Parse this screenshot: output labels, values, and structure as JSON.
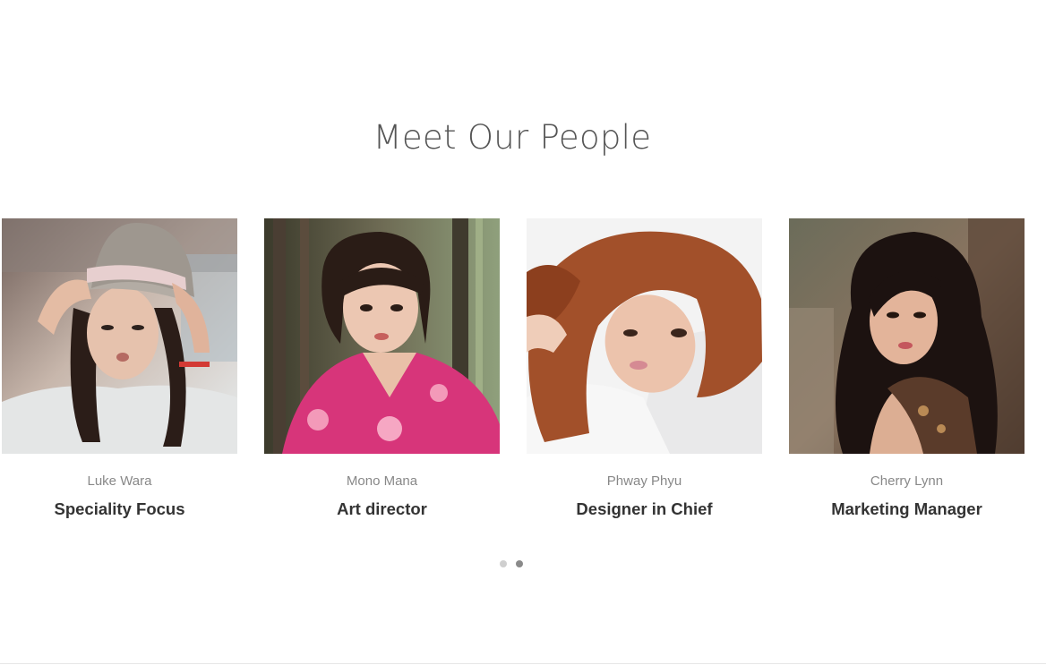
{
  "section": {
    "title": "Meet Our People"
  },
  "team": [
    {
      "name": "Luke Wara",
      "role": "Speciality Focus",
      "photo_icon": "portrait-woman-hat"
    },
    {
      "name": "Mono Mana",
      "role": "Art director",
      "photo_icon": "portrait-woman-pink-kimono"
    },
    {
      "name": "Phway Phyu",
      "role": "Designer in Chief",
      "photo_icon": "portrait-woman-red-hair"
    },
    {
      "name": "Cherry Lynn",
      "role": "Marketing Manager",
      "photo_icon": "portrait-woman-dark-curls"
    }
  ],
  "carousel": {
    "pages": 2,
    "active_page": 2
  },
  "colors": {
    "title": "#555555",
    "name": "#888888",
    "role": "#333333",
    "dot_inactive": "#cfcfcf",
    "dot_active": "#8a8a8a"
  }
}
